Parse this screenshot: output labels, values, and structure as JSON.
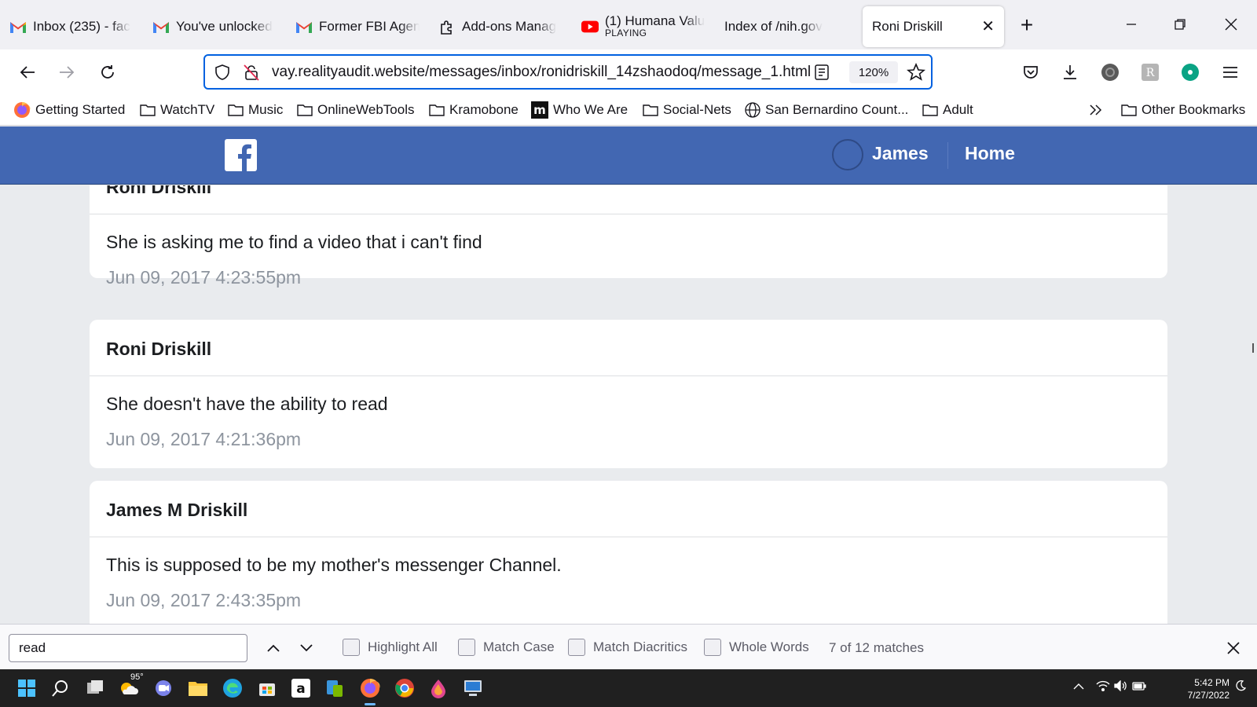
{
  "tabs": [
    {
      "title": "Inbox (235) - fac",
      "icon": "gmail-icon"
    },
    {
      "title": "You've unlocked",
      "icon": "gmail-icon"
    },
    {
      "title": "Former FBI Agen",
      "icon": "gmail-icon"
    },
    {
      "title": "Add-ons Manag",
      "icon": "puzzle-icon"
    },
    {
      "title": "(1) Humana Valu",
      "subtitle": "PLAYING",
      "icon": "youtube-icon"
    },
    {
      "title": "Index of /nih.gov",
      "icon": "none"
    },
    {
      "title": "Roni Driskill",
      "icon": "none",
      "active": true
    }
  ],
  "address_bar": {
    "url": "vay.realityaudit.website/messages/inbox/ronidriskill_14zshaodoq/message_1.html",
    "zoom": "120%"
  },
  "bookmarks": [
    {
      "label": "Getting Started",
      "icon": "firefox-icon"
    },
    {
      "label": "WatchTV",
      "icon": "folder-icon"
    },
    {
      "label": "Music",
      "icon": "folder-icon"
    },
    {
      "label": "OnlineWebTools",
      "icon": "folder-icon"
    },
    {
      "label": "Kramobone",
      "icon": "folder-icon"
    },
    {
      "label": "Who We Are",
      "icon": "m-logo-icon"
    },
    {
      "label": "Social-Nets",
      "icon": "folder-icon"
    },
    {
      "label": "San Bernardino Count...",
      "icon": "globe-icon"
    },
    {
      "label": "Adult",
      "icon": "folder-icon"
    },
    {
      "label": "Other Bookmarks",
      "icon": "folder-icon"
    }
  ],
  "fb_header": {
    "user_name": "James",
    "home_label": "Home"
  },
  "messages": [
    {
      "sender": "Roni Driskill",
      "text": "She is asking me to find a video that i can't find",
      "time": "Jun 09, 2017 4:23:55pm"
    },
    {
      "sender": "Roni Driskill",
      "text": "She doesn't have the ability to read",
      "time": "Jun 09, 2017 4:21:36pm"
    },
    {
      "sender": "James M Driskill",
      "text": "This is supposed to be my mother's messenger Channel.",
      "time": "Jun 09, 2017 2:43:35pm"
    }
  ],
  "find_bar": {
    "query": "read",
    "highlight_all": "Highlight All",
    "match_case": "Match Case",
    "match_diacritics": "Match Diacritics",
    "whole_words": "Whole Words",
    "matches": "7 of 12 matches"
  },
  "taskbar": {
    "weather_temp": "95°",
    "time": "5:42 PM",
    "date": "7/27/2022"
  },
  "colors": {
    "facebook_blue": "#4267b2",
    "url_focus": "#0061e0",
    "timestamp_gray": "#8d949e"
  }
}
